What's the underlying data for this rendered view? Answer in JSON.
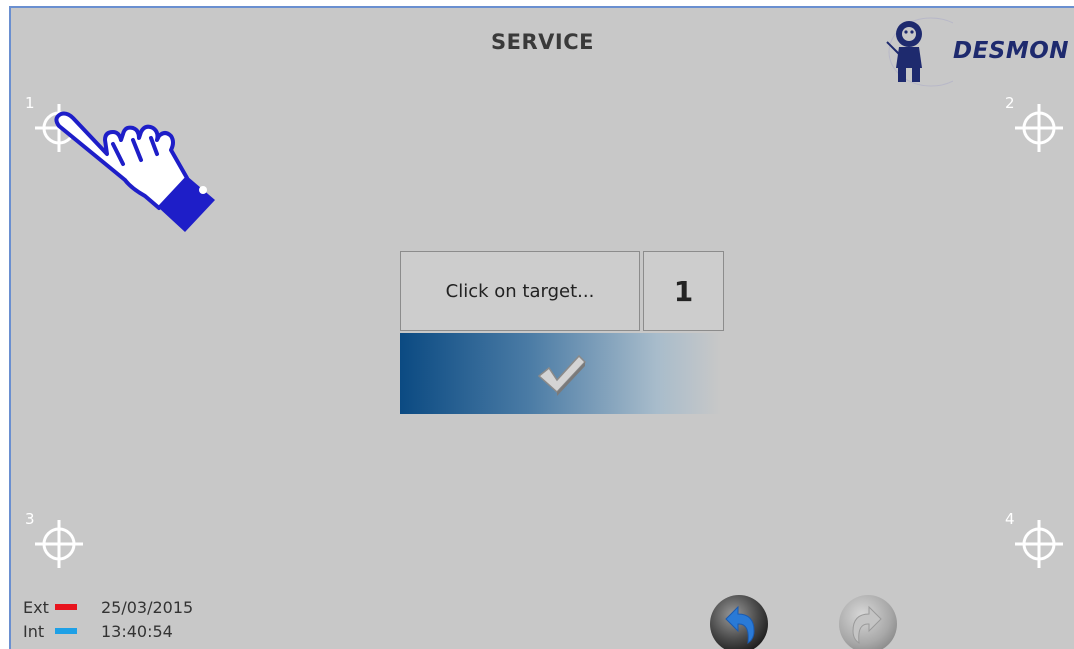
{
  "header": {
    "title": "SERVICE"
  },
  "logo": {
    "text": "DESMON",
    "icon": "desmon-mascot-logo"
  },
  "targets": [
    {
      "number": "1",
      "icon": "crosshair-icon"
    },
    {
      "number": "2",
      "icon": "crosshair-icon"
    },
    {
      "number": "3",
      "icon": "crosshair-icon"
    },
    {
      "number": "4",
      "icon": "crosshair-icon"
    }
  ],
  "pointer": {
    "icon": "pointing-hand-icon",
    "color": "#1e1ec8"
  },
  "calibration": {
    "prompt": "Click on target...",
    "current_target": "1",
    "confirm_icon": "checkmark-icon"
  },
  "status": {
    "ext_label": "Ext",
    "ext_color": "#e8141e",
    "int_label": "Int",
    "int_color": "#1ea0e6",
    "date": "25/03/2015",
    "time": "13:40:54"
  },
  "nav": {
    "back_icon": "undo-arrow-icon",
    "forward_icon": "redo-arrow-icon"
  }
}
